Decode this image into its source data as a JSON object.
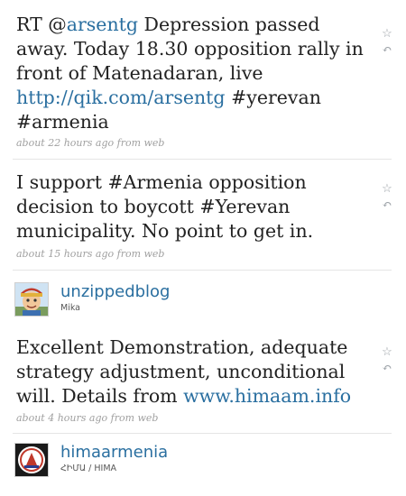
{
  "tweets": [
    {
      "parts": [
        {
          "t": "RT @",
          "link": false
        },
        {
          "t": "arsentg",
          "link": true
        },
        {
          "t": " Depression passed away. Today 18.30 opposition rally in front of Matenadaran, live ",
          "link": false
        },
        {
          "t": "http://qik.com/arsentg",
          "link": true
        },
        {
          "t": " #yerevan #armenia",
          "link": false
        }
      ],
      "meta": "about 22 hours ago from web"
    },
    {
      "parts": [
        {
          "t": "I support #Armenia opposition decision to boycott #Yerevan municipality. No point to get in.",
          "link": false
        }
      ],
      "meta": "about 15 hours ago from web"
    },
    {
      "parts": [
        {
          "t": "Excellent Demonstration, adequate strategy adjustment, unconditional will. Details from ",
          "link": false
        },
        {
          "t": "www.himaam.info",
          "link": true
        }
      ],
      "meta": "about 4 hours ago from web"
    }
  ],
  "users": [
    {
      "screen_name": "unzippedblog",
      "full_name": "Mika",
      "avatar_icon": "cartoon-avatar-icon"
    },
    {
      "screen_name": "himaarmenia",
      "full_name": "ՀԻՄԱ / HIMA",
      "avatar_icon": "hima-logo-icon"
    }
  ],
  "icons": {
    "favorite": "star-icon",
    "reply": "reply-arrow-icon"
  },
  "colors": {
    "link": "#2a6fa0",
    "text": "#222222",
    "meta": "#a0a0a0"
  }
}
